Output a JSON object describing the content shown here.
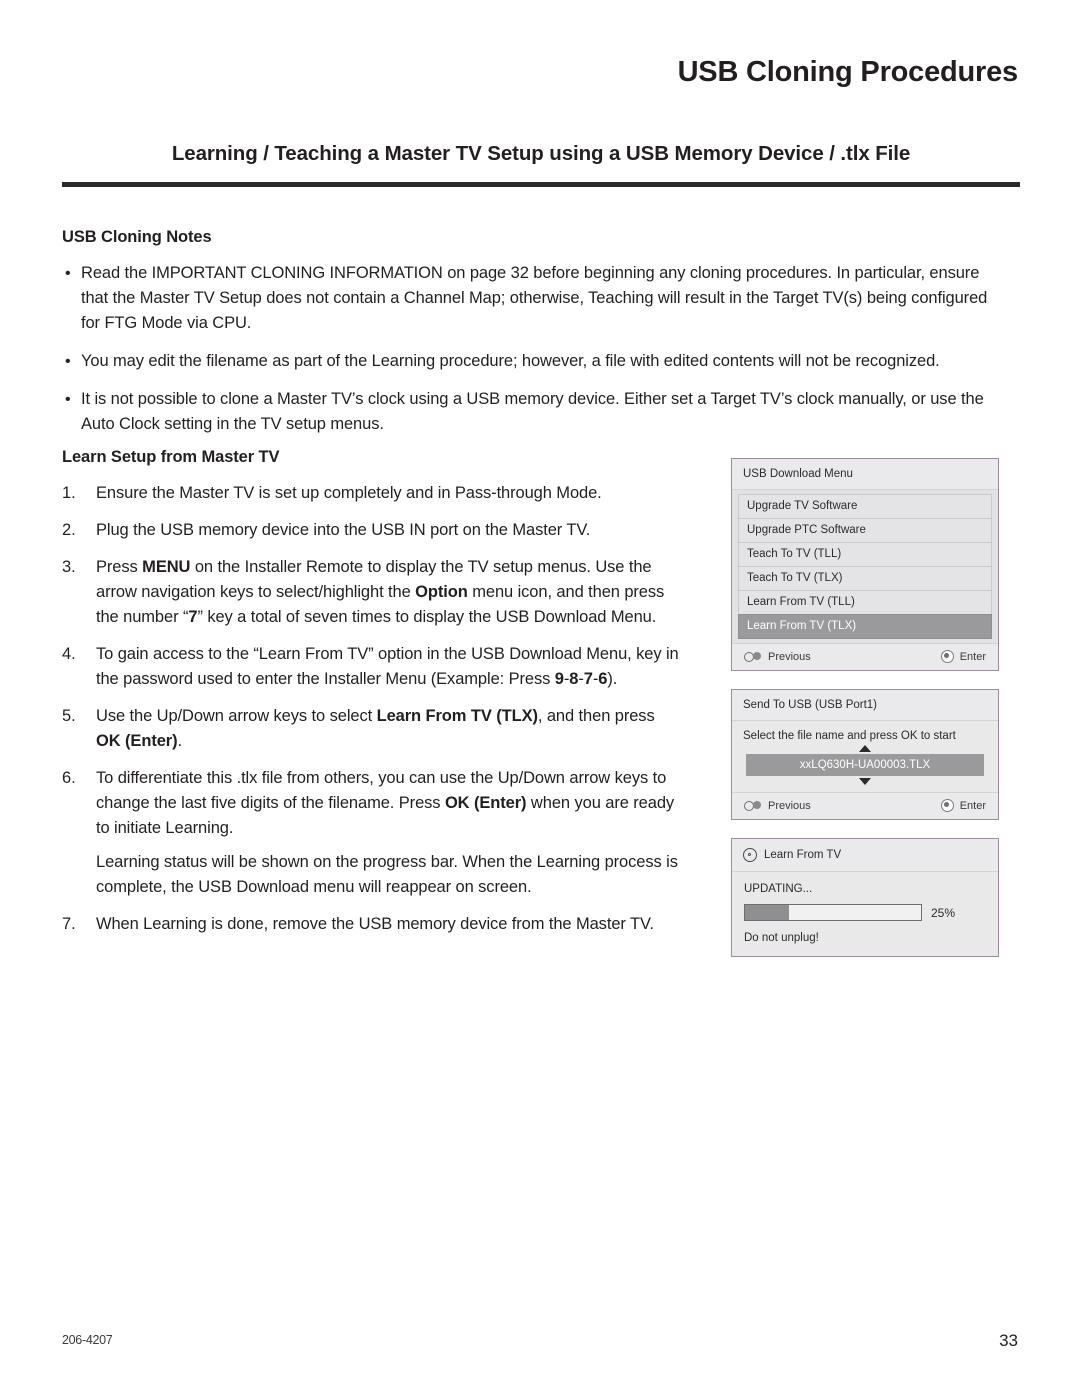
{
  "page": {
    "title": "USB Cloning Procedures",
    "section_title": "Learning / Teaching a Master TV Setup using a USB Memory Device / .tlx File"
  },
  "notes": {
    "heading": "USB Cloning Notes",
    "bullet_glyph": "•",
    "items": [
      "Read the IMPORTANT CLONING INFORMATION on page 32 before beginning any cloning procedures. In particular, ensure that the Master TV Setup does not contain a Channel Map; otherwise, Teaching will result in the Target TV(s) being configured for FTG Mode via CPU.",
      "You may edit the filename as part of the Learning procedure; however, a file with edited contents will not be recognized.",
      "It is not possible to clone a Master TV’s clock using a USB memory device. Either set a Target TV’s clock manually, or use the Auto Clock setting in the TV setup menus."
    ]
  },
  "procedure": {
    "heading": "Learn Setup from Master TV",
    "steps": [
      {
        "num": "1.",
        "text_html": "Ensure the Master TV is set up completely and in Pass-through Mode."
      },
      {
        "num": "2.",
        "text_html": "Plug the USB memory device into the USB IN port on the Master TV."
      },
      {
        "num": "3.",
        "text_html": "Press <b>MENU</b> on the Installer Remote to display the TV setup menus. Use the arrow navigation keys to select/highlight the <b>Option</b> menu icon, and then press the number “<b>7</b>” key a total of seven times to display the USB Download Menu."
      },
      {
        "num": "4.",
        "text_html": "To gain access to the “Learn From TV” option in the USB Download Menu, key in the password used to enter the Installer Menu (Example: Press <b>9</b>-<b>8</b>-<b>7</b>-<b>6</b>)."
      },
      {
        "num": "5.",
        "text_html": "Use the Up/Down arrow keys to select <b>Learn From TV (TLX)</b>, and then press <b>OK (Enter)</b>."
      },
      {
        "num": "6.",
        "text_html": "To differentiate this .tlx file from others, you can use the Up/Down arrow keys to change the last five digits of the filename. Press <b>OK (Enter)</b> when you are ready to initiate Learning.",
        "continuation_html": "Learning status will be shown on the progress bar. When the Learning process is complete, the USB Download menu will reappear on screen."
      },
      {
        "num": "7.",
        "text_html": "When Learning is done, remove the USB memory device from the Master TV."
      }
    ]
  },
  "osd": {
    "download_menu": {
      "title": "USB Download Menu",
      "items": [
        {
          "label": "Upgrade TV Software",
          "selected": false
        },
        {
          "label": "Upgrade PTC Software",
          "selected": false
        },
        {
          "label": "Teach To TV (TLL)",
          "selected": false
        },
        {
          "label": "Teach To TV (TLX)",
          "selected": false
        },
        {
          "label": "Learn From TV (TLL)",
          "selected": false
        },
        {
          "label": "Learn From TV (TLX)",
          "selected": true
        }
      ],
      "previous_label": "Previous",
      "enter_label": "Enter"
    },
    "send_to_usb": {
      "title": "Send To USB (USB Port1)",
      "instruction": "Select the file name and press OK to start",
      "filename": "xxLQ630H-UA00003.TLX",
      "previous_label": "Previous",
      "enter_label": "Enter"
    },
    "learn_from_tv": {
      "title": "Learn From TV",
      "status": "UPDATING...",
      "progress_percent": 25,
      "progress_label": "25%",
      "warning": "Do not unplug!"
    },
    "colors": {
      "panel_border": "#9c8d9c",
      "panel_bg": "#e9e9ea",
      "selected_row": "#9a9a9c",
      "progress_fill": "#8f8f91"
    }
  },
  "footer": {
    "doc_number": "206-4207",
    "page_number": "33"
  }
}
